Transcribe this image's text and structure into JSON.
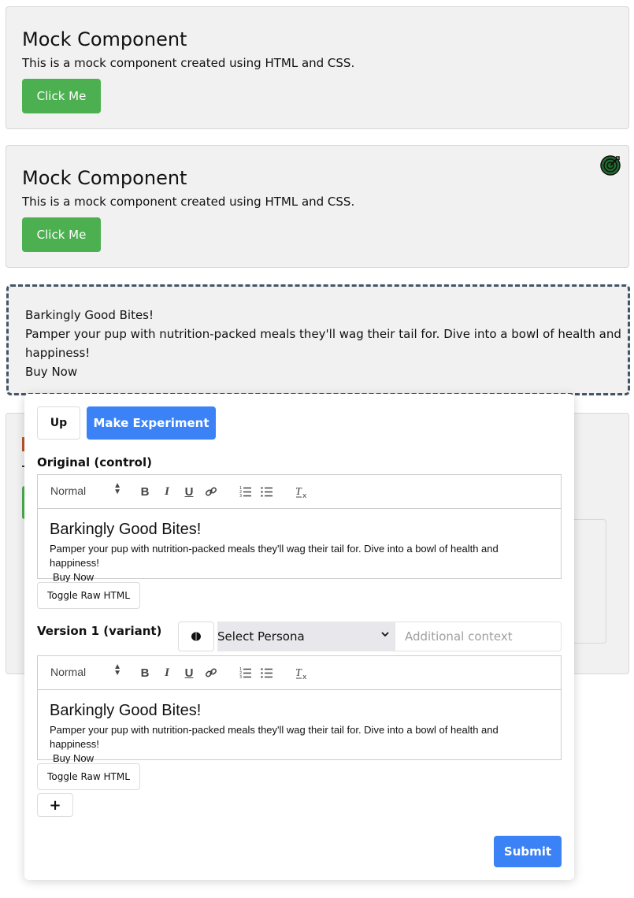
{
  "card1": {
    "title": "Mock Component",
    "text": "This is a mock component created using HTML and CSS.",
    "button": "Click Me"
  },
  "card2": {
    "title": "Mock Component",
    "text": "This is a mock component created using HTML and CSS.",
    "button": "Click Me",
    "icon": "target-icon"
  },
  "dashed_block": {
    "heading": "Barkingly Good Bites!",
    "body": "Pamper your pup with nutrition-packed meals they'll wag their tail for. Dive into a bowl of health and happiness!",
    "cta": "Buy Now"
  },
  "panel": {
    "up_button": "Up",
    "make_experiment_button": "Make Experiment",
    "original_label": "Original (control)",
    "variant_label": "Version 1 (variant)",
    "toolbar": {
      "format_select": "Normal",
      "icons": [
        "bold-icon",
        "italic-icon",
        "underline-icon",
        "link-icon",
        "ordered-list-icon",
        "bullet-list-icon",
        "clear-format-icon"
      ]
    },
    "original_editor": {
      "heading": "Barkingly Good Bites!",
      "body": "Pamper your pup with nutrition-packed meals they'll wag their tail for. Dive into a bowl of health and happiness!",
      "cta": "Buy Now"
    },
    "variant_editor": {
      "heading": "Barkingly Good Bites!",
      "body": "Pamper your pup with nutrition-packed meals they'll wag their tail for. Dive into a bowl of health and happiness!",
      "cta": "Buy Now"
    },
    "toggle_raw_html": "Toggle Raw HTML",
    "persona_select": "Select Persona",
    "context_placeholder": "Additional context",
    "add_button": "+",
    "submit_button": "Submit",
    "brain_icon": "brain-icon"
  },
  "colors": {
    "green_button": "#4caf50",
    "blue_button": "#3b82f6",
    "card_bg": "#f1f1f1",
    "dashed_border": "#445566"
  }
}
